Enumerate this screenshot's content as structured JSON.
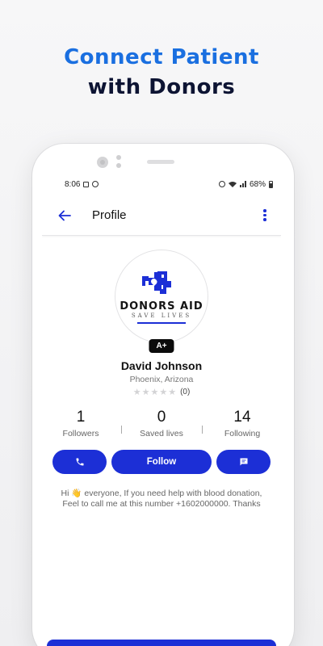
{
  "headline": {
    "line1": "Connect Patient",
    "line2": "with Donors"
  },
  "status_bar": {
    "time": "8:06",
    "battery": "68%"
  },
  "app_bar": {
    "title": "Profile"
  },
  "profile": {
    "logo_title": "DONORS AID",
    "logo_subtitle": "SAVE LIVES",
    "blood_type": "A+",
    "name": "David Johnson",
    "location": "Phoenix, Arizona",
    "rating_count": "(0)",
    "stars": 0,
    "bio": "Hi 👋 everyone, If you need help with blood donation, Feel to call me at this number +1602000000. Thanks"
  },
  "stats": [
    {
      "value": "1",
      "label": "Followers"
    },
    {
      "value": "0",
      "label": "Saved lives"
    },
    {
      "value": "14",
      "label": "Following"
    }
  ],
  "actions": {
    "follow_label": "Follow"
  },
  "icons": {
    "back": "arrow-left-icon",
    "more": "more-vertical-icon",
    "call": "phone-icon",
    "message": "message-icon"
  },
  "colors": {
    "primary": "#1c2fd6",
    "headline_blue": "#1a6fe0",
    "headline_dark": "#0d1433"
  }
}
